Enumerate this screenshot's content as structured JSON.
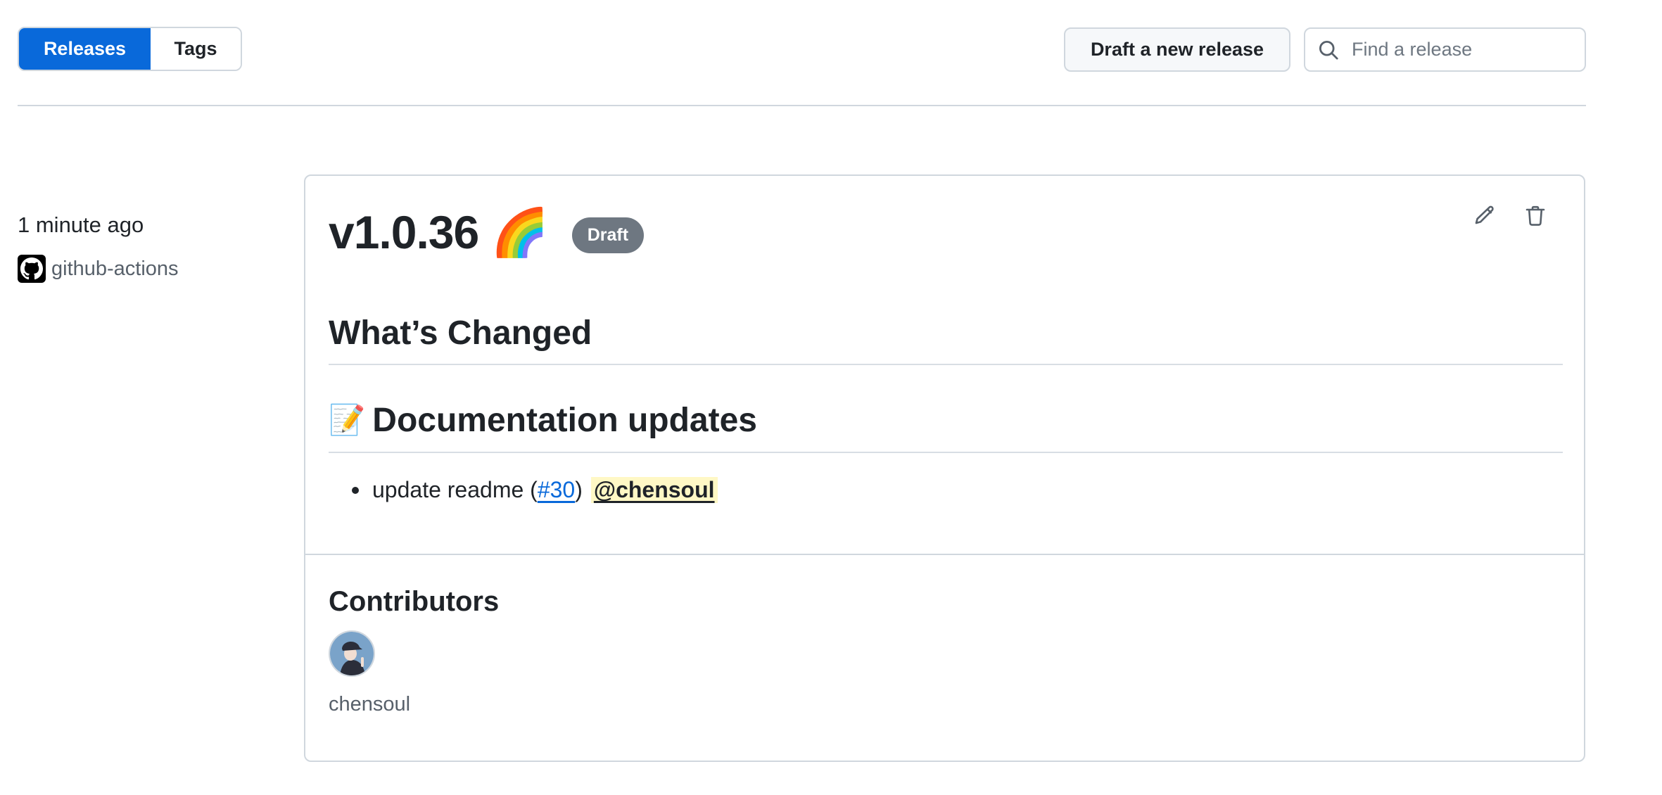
{
  "header": {
    "tabs": [
      {
        "label": "Releases",
        "active": true
      },
      {
        "label": "Tags",
        "active": false
      }
    ],
    "draft_button": "Draft a new release",
    "search": {
      "placeholder": "Find a release",
      "value": ""
    }
  },
  "release": {
    "time_ago": "1 minute ago",
    "author": "github-actions",
    "title": "v1.0.36 🌈",
    "status_badge": "Draft",
    "actions": [
      "edit",
      "delete"
    ],
    "body": {
      "heading": "What’s Changed",
      "sections": [
        {
          "emoji": "📝",
          "heading": "Documentation updates",
          "items": [
            {
              "text": "update readme (",
              "pr": "#30",
              "close": ")",
              "mention": "@chensoul"
            }
          ]
        }
      ]
    },
    "contributors": {
      "heading": "Contributors",
      "people": [
        {
          "name": "chensoul"
        }
      ]
    }
  },
  "colors": {
    "accent": "#0969da",
    "badge": "#6e7781",
    "mention_bg": "#fff8c5",
    "border": "#d0d7de",
    "text": "#1f2328",
    "muted": "#57606a"
  }
}
